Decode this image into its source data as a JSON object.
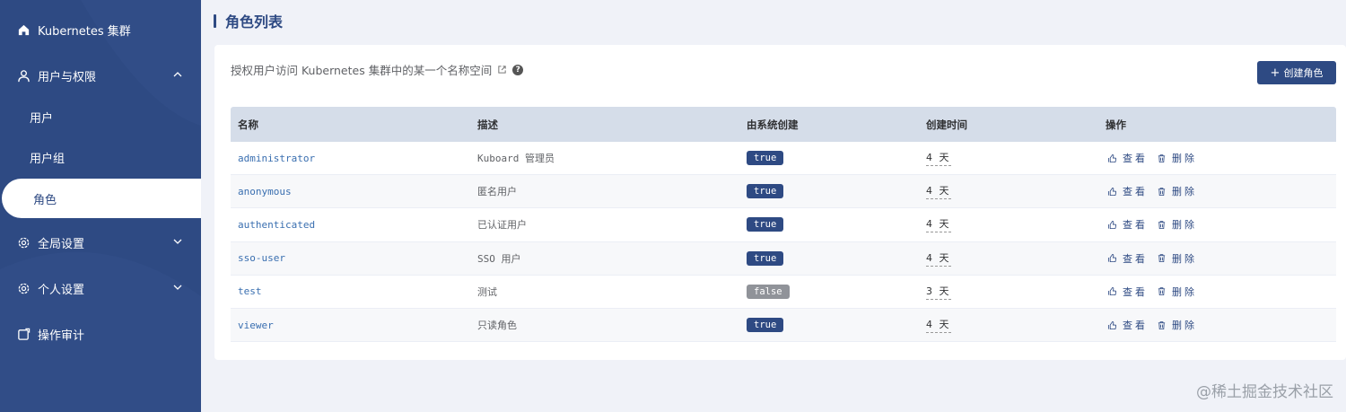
{
  "sidebar": {
    "items": [
      {
        "label": "Kubernetes 集群",
        "icon": "home-icon"
      },
      {
        "label": "用户与权限",
        "icon": "user-icon"
      },
      {
        "label": "全局设置",
        "icon": "gear-icon"
      },
      {
        "label": "个人设置",
        "icon": "gear-icon"
      },
      {
        "label": "操作审计",
        "icon": "audit-icon"
      }
    ],
    "sub_items": [
      {
        "label": "用户"
      },
      {
        "label": "用户组"
      },
      {
        "label": "角色"
      }
    ]
  },
  "page": {
    "title": "角色列表",
    "description": "授权用户访问 Kubernetes 集群中的某一个名称空间",
    "help": "?",
    "create_button": "创建角色",
    "create_plus": "+"
  },
  "table": {
    "headers": [
      "名称",
      "描述",
      "由系统创建",
      "创建时间",
      "操作"
    ],
    "rows": [
      {
        "name": "administrator",
        "desc": "Kuboard 管理员",
        "system": "true",
        "time": "4 天"
      },
      {
        "name": "anonymous",
        "desc": "匿名用户",
        "system": "true",
        "time": "4 天"
      },
      {
        "name": "authenticated",
        "desc": "已认证用户",
        "system": "true",
        "time": "4 天"
      },
      {
        "name": "sso-user",
        "desc": "SSO 用户",
        "system": "true",
        "time": "4 天"
      },
      {
        "name": "test",
        "desc": "测试",
        "system": "false",
        "time": "3 天"
      },
      {
        "name": "viewer",
        "desc": "只读角色",
        "system": "true",
        "time": "4 天"
      }
    ],
    "action_view": "查看",
    "action_delete": "删除"
  },
  "watermark": "@稀土掘金技术社区",
  "colors": {
    "sidebar": "#2e4a83",
    "accent": "#2e4a83",
    "false_badge": "#909399"
  }
}
